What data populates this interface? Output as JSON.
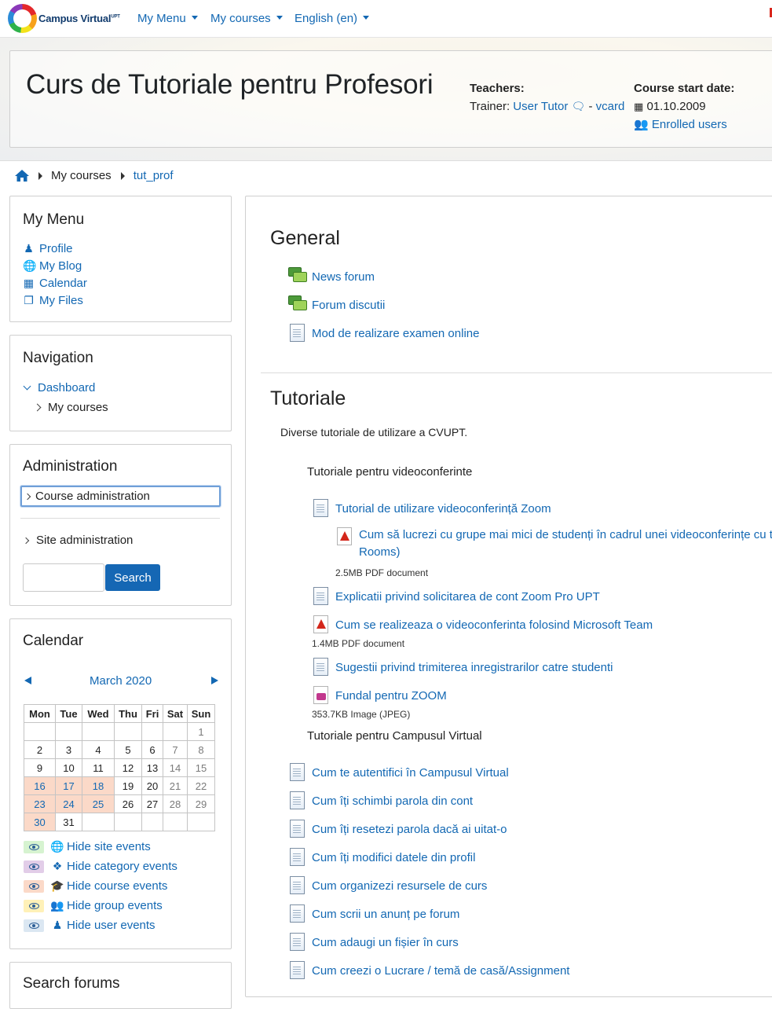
{
  "navbar": {
    "logo_text": "Campus Virtual",
    "logo_sup": "UPT",
    "menu_label": "My Menu",
    "courses_label": "My courses",
    "language_label": "English (en)"
  },
  "header": {
    "course_title": "Curs de Tutoriale pentru Profesori",
    "teachers_label": "Teachers:",
    "trainer_prefix": "Trainer:",
    "trainer_name": "User Tutor",
    "vcard_sep": "-",
    "vcard_label": "vcard",
    "start_date_label": "Course start date:",
    "start_date": "01.10.2009",
    "enrolled_users": "Enrolled users"
  },
  "breadcrumb": {
    "items": [
      "My courses",
      "tut_prof"
    ]
  },
  "my_menu": {
    "title": "My Menu",
    "items": [
      "Profile",
      "My Blog",
      "Calendar",
      "My Files"
    ]
  },
  "navigation": {
    "title": "Navigation",
    "dashboard": "Dashboard",
    "my_courses": "My courses"
  },
  "administration": {
    "title": "Administration",
    "course_admin": "Course administration",
    "site_admin": "Site administration",
    "search_button": "Search"
  },
  "calendar": {
    "title": "Calendar",
    "month": "March 2020",
    "weekdays": [
      "Mon",
      "Tue",
      "Wed",
      "Thu",
      "Fri",
      "Sat",
      "Sun"
    ],
    "weeks": [
      [
        "",
        "",
        "",
        "",
        "",
        "",
        "1"
      ],
      [
        "2",
        "3",
        "4",
        "5",
        "6",
        "7",
        "8"
      ],
      [
        "9",
        "10",
        "11",
        "12",
        "13",
        "14",
        "15"
      ],
      [
        "16",
        "17",
        "18",
        "19",
        "20",
        "21",
        "22"
      ],
      [
        "23",
        "24",
        "25",
        "26",
        "27",
        "28",
        "29"
      ],
      [
        "30",
        "31",
        "",
        "",
        "",
        "",
        ""
      ]
    ],
    "highlighted_days": [
      "16",
      "17",
      "18",
      "23",
      "24",
      "25",
      "30"
    ],
    "legend": [
      {
        "label": "Hide site events",
        "color": "#d6f3d0",
        "icon": "globe-icon"
      },
      {
        "label": "Hide category events",
        "color": "#e2cde8",
        "icon": "cubes-icon"
      },
      {
        "label": "Hide course events",
        "color": "#fbd9c8",
        "icon": "graduation-cap-icon"
      },
      {
        "label": "Hide group events",
        "color": "#fff1b8",
        "icon": "users-icon"
      },
      {
        "label": "Hide user events",
        "color": "#dbe7f2",
        "icon": "user-icon"
      }
    ]
  },
  "search_forums": {
    "title": "Search forums"
  },
  "sections": {
    "general": {
      "title": "General",
      "activities": [
        "News forum",
        "Forum discutii",
        "Mod de realizare examen online"
      ]
    },
    "tutoriale": {
      "title": "Tutoriale",
      "summary": "Diverse tutoriale de utilizare a CVUPT.",
      "sub1_label": "Tutoriale pentru videoconferinte",
      "a1": "Tutorial de utilizare videoconferință Zoom",
      "a2_line1": "Cum să lucrezi cu grupe mai mici de studenți în cadrul unei videoconferințe cu toți",
      "a2_line2": "Rooms)",
      "a2_meta": "2.5MB PDF document",
      "a3": "Explicatii privind solicitarea de cont Zoom Pro UPT",
      "a4": "Cum se realizeaza o videoconferinta folosind Microsoft Team",
      "a4_meta": "1.4MB PDF document",
      "a5": "Sugestii privind trimiterea inregistrarilor catre studenti",
      "a6": "Fundal pentru ZOOM",
      "a6_meta": "353.7KB Image (JPEG)",
      "sub2_label": "Tutoriale pentru Campusul Virtual",
      "campus_activities": [
        "Cum te autentifici în Campusul Virtual",
        "Cum îți schimbi parola din cont",
        "Cum îți resetezi parola dacă ai uitat-o",
        "Cum îți modifici datele din profil",
        "Cum organizezi resursele de curs",
        "Cum scrii un anunț pe forum",
        "Cum adaugi un fișier în curs",
        "Cum creezi o Lucrare / temă de casă/Assignment"
      ]
    }
  }
}
